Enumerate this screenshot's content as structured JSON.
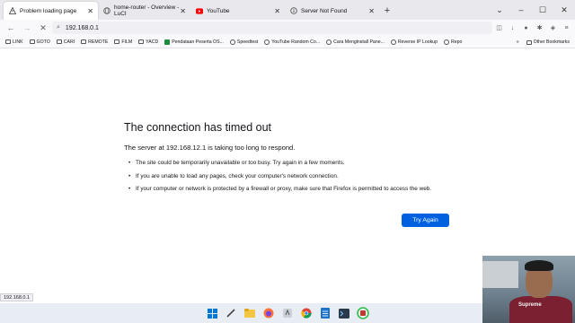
{
  "tabs": [
    {
      "label": "Problem loading page",
      "active": true
    },
    {
      "label": "home-router - Overview - LuCI",
      "active": false
    },
    {
      "label": "YouTube",
      "active": false
    },
    {
      "label": "Server Not Found",
      "active": false
    }
  ],
  "address_bar": {
    "value": "192.168.0.1"
  },
  "bookmarks": [
    "LINK",
    "GOTO",
    "CARI",
    "REMOTE",
    "FILM",
    "YACD",
    "Pendataan Peserta OS...",
    "Speedtest",
    "YouTube Random Co...",
    "Cara Menginstall Pane...",
    "Reverse IP Lookup",
    "Repo"
  ],
  "bookmarks_other": "Other Bookmarks",
  "error_page": {
    "title": "The connection has timed out",
    "subtitle": "The server at 192.168.12.1 is taking too long to respond.",
    "bullets": [
      "The site could be temporarily unavailable or too busy. Try again in a few moments.",
      "If you are unable to load any pages, check your computer's network connection.",
      "If your computer or network is protected by a firewall or proxy, make sure that Firefox is permitted to access the web."
    ],
    "button_label": "Try Again"
  },
  "status_bar": "192.168.0.1",
  "webcam_shirt_text": "Supreme",
  "colors": {
    "accent": "#0061e0",
    "youtube": "#ff0000"
  }
}
